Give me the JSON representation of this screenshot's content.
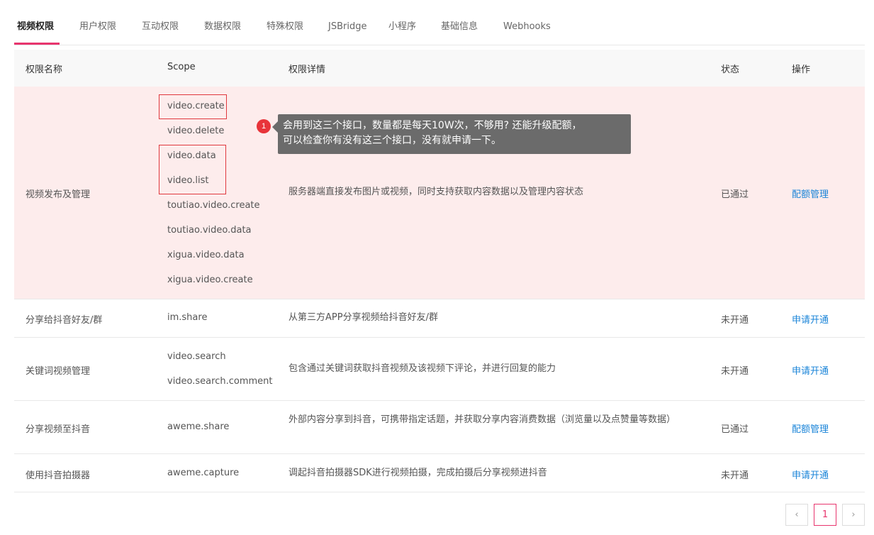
{
  "tabs": [
    {
      "label": "视频权限",
      "active": true
    },
    {
      "label": "用户权限"
    },
    {
      "label": "互动权限"
    },
    {
      "label": "数据权限"
    },
    {
      "label": "特殊权限"
    },
    {
      "label": "JSBridge"
    },
    {
      "label": "小程序"
    },
    {
      "label": "基础信息"
    },
    {
      "label": "Webhooks"
    }
  ],
  "table": {
    "headers": {
      "name": "权限名称",
      "scope": "Scope",
      "detail": "权限详情",
      "status": "状态",
      "action": "操作"
    },
    "rows": [
      {
        "name": "视频发布及管理",
        "scopes": [
          "video.create",
          "video.delete",
          "video.data",
          "video.list",
          "toutiao.video.create",
          "toutiao.video.data",
          "xigua.video.data",
          "xigua.video.create"
        ],
        "detail": "服务器端直接发布图片或视频，同时支持获取内容数据以及管理内容状态",
        "status": "已通过",
        "action": "配额管理",
        "highlighted": true
      },
      {
        "name": "分享给抖音好友/群",
        "scopes": [
          "im.share"
        ],
        "detail": "从第三方APP分享视频给抖音好友/群",
        "status": "未开通",
        "action": "申请开通"
      },
      {
        "name": "关键词视频管理",
        "scopes": [
          "video.search",
          "video.search.comment"
        ],
        "detail": "包含通过关键词获取抖音视频及该视频下评论，并进行回复的能力",
        "status": "未开通",
        "action": "申请开通"
      },
      {
        "name": "分享视频至抖音",
        "scopes": [
          "aweme.share"
        ],
        "detail": "外部内容分享到抖音，可携带指定话题，并获取分享内容消费数据（浏览量以及点赞量等数据）",
        "status": "已通过",
        "action": "配额管理"
      },
      {
        "name": "使用抖音拍摄器",
        "scopes": [
          "aweme.capture"
        ],
        "detail": "调起抖音拍摄器SDK进行视频拍摄，完成拍摄后分享视频进抖音",
        "status": "未开通",
        "action": "申请开通"
      }
    ]
  },
  "annotation": {
    "number": "1",
    "lines": [
      "会用到这三个接口，数量都是每天10W次，不够用? 还能升级配额，",
      "可以检查你有没有这三个接口，没有就申请一下。"
    ]
  },
  "pagination": {
    "prev": "‹",
    "current": "1",
    "next": "›"
  },
  "colors": {
    "accent": "#e8356e",
    "link": "#1a84d8",
    "highlight_row": "#fdecec",
    "annotation_box": "#e0383e",
    "tooltip_bg": "#6b6b6b"
  }
}
